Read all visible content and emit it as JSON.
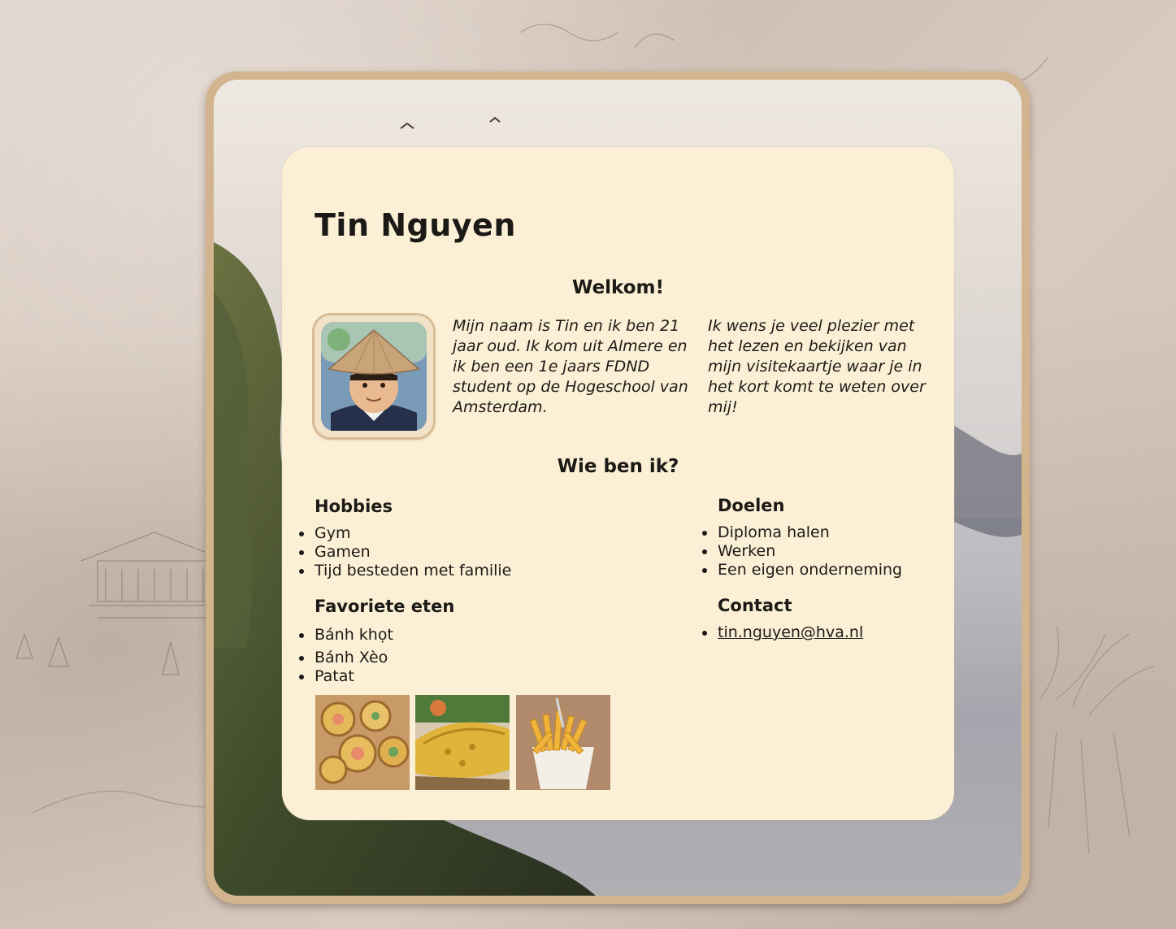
{
  "name": "Tin Nguyen",
  "welcome": {
    "heading": "Welkom!",
    "intro": "Mijn naam is Tin en ik ben 21 jaar oud. Ik kom uit Almere en ik ben een 1e jaars FDND student op de Hogeschool van Amsterdam.",
    "wish": "Ik wens je veel plezier met het lezen en bekijken van mijn visitekaartje waar je in het kort komt te weten over mij!"
  },
  "about": {
    "heading": "Wie ben ik?",
    "hobbies": {
      "title": "Hobbies",
      "items": [
        "Gym",
        "Gamen",
        "Tijd besteden met familie"
      ]
    },
    "goals": {
      "title": "Doelen",
      "items": [
        "Diploma halen",
        "Werken",
        "Een eigen onderneming"
      ]
    },
    "food": {
      "title": "Favoriete eten",
      "items": [
        "Bánh khọt",
        "Bánh Xèo",
        "Patat"
      ]
    },
    "contact": {
      "title": "Contact",
      "email": "tin.nguyen@hva.nl"
    }
  },
  "colors": {
    "card": "#fbefd5",
    "frame": "#d2b48e",
    "text": "#1c1a16"
  },
  "icons": [
    "profile-photo",
    "banh-khot-photo",
    "banh-xeo-photo",
    "patat-photo"
  ]
}
